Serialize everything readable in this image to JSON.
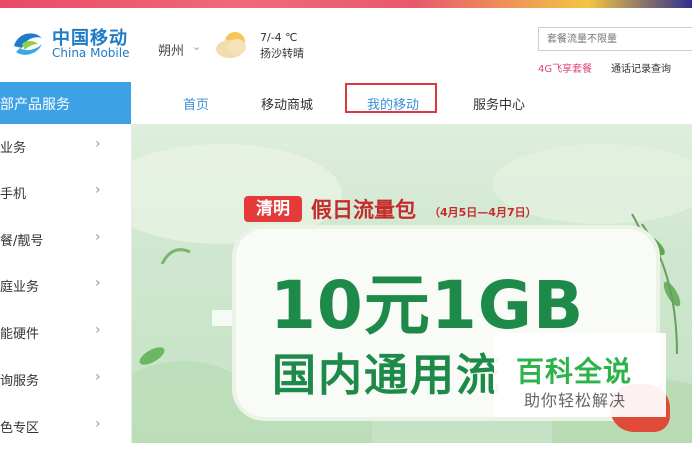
{
  "header": {
    "brand_cn": "中国移动",
    "brand_en": "China Mobile",
    "city": "朔州",
    "city_chevron": "⌄",
    "temperature": "7/-4 ℃",
    "weather": "扬沙转晴",
    "search_placeholder": "套餐流量不限量",
    "hot_links": [
      "4G飞享套餐",
      "通话记录查询"
    ]
  },
  "sidebar": {
    "title": "部产品服务",
    "items": [
      {
        "label": "业务"
      },
      {
        "label": "手机"
      },
      {
        "label": "餐/靓号"
      },
      {
        "label": "庭业务"
      },
      {
        "label": "能硬件"
      },
      {
        "label": "询服务"
      },
      {
        "label": "色专区"
      }
    ],
    "chevron": "›"
  },
  "nav": {
    "items": [
      "首页",
      "移动商城",
      "我的移动",
      "服务中心"
    ],
    "highlighted": "我的移动"
  },
  "banner": {
    "tag": "清明",
    "title": "假日流量包",
    "date": "（4月5日—4月7日）",
    "price_line": "10元1GB",
    "sub_line": "国内通用流"
  },
  "watermark": {
    "title": "百科全说",
    "subtitle": "助你轻松解决"
  },
  "colors": {
    "brand_blue": "#1f7ac8",
    "sidebar_blue": "#3da1e6",
    "nav_active": "#3a90d8",
    "highlight_red": "#d9393f",
    "promo_red": "#c62b2b",
    "promo_green": "#1e8a4a",
    "watermark_green": "#2db349"
  },
  "icons": {
    "logo": "china-mobile-logo-icon",
    "weather": "cloud-sun-icon",
    "chevron": "chevron-right-icon"
  }
}
